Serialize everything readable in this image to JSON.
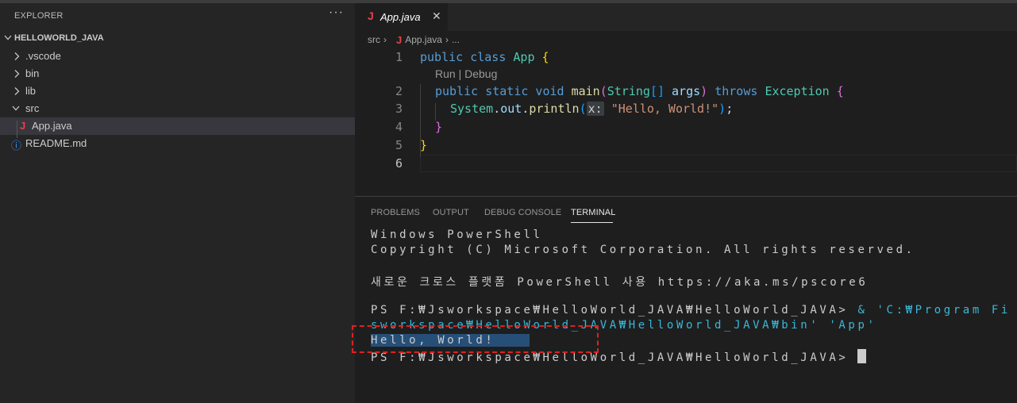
{
  "sidebar": {
    "header": "EXPLORER",
    "more": "···",
    "section_title": "HELLOWORLD_JAVA",
    "items": [
      {
        "label": ".vscode"
      },
      {
        "label": "bin"
      },
      {
        "label": "lib"
      },
      {
        "label": "src"
      },
      {
        "label": "App.java",
        "icon": "J"
      },
      {
        "label": "README.md",
        "icon": "ⓘ"
      }
    ]
  },
  "editor": {
    "tab": {
      "icon": "J",
      "label": "App.java",
      "close": "✕"
    },
    "breadcrumb": {
      "part1": "src",
      "sep": "›",
      "icon": "J",
      "part2": "App.java",
      "sep2": "›",
      "part3": "..."
    },
    "line_numbers": [
      "1",
      "2",
      "3",
      "4",
      "5",
      "6"
    ],
    "codelens": "Run | Debug",
    "code": {
      "l1_kw": "public class",
      "l1_cls": "App",
      "l1_brace": "{",
      "l2_kw": "public static void",
      "l2_fn": "main",
      "l2_paren_open": "(",
      "l2_type": "String",
      "l2_arr": "[]",
      "l2_param": "args",
      "l2_paren_close": ")",
      "l2_throws": "throws",
      "l2_exc": "Exception",
      "l2_brace": "{",
      "l3_sys": "System",
      "l3_dot1": ".",
      "l3_out": "out",
      "l3_dot2": ".",
      "l3_fn": "println",
      "l3_paren_open": "(",
      "l3_hint": "x:",
      "l3_str": "\"Hello, World!\"",
      "l3_paren_close": ")",
      "l3_semi": ";",
      "l4_brace": "}",
      "l5_brace": "}"
    }
  },
  "panel": {
    "tabs": [
      "PROBLEMS",
      "OUTPUT",
      "DEBUG CONSOLE",
      "TERMINAL"
    ],
    "active_tab": "TERMINAL",
    "terminal": {
      "line1": "Windows PowerShell",
      "line2": "Copyright (C) Microsoft Corporation. All rights reserved.",
      "line3": "새로운 크로스 플랫폼 PowerShell 사용 https://aka.ms/pscore6",
      "line4_prompt": "PS F:₩Jsworkspace₩HelloWorld_JAVA₩HelloWorld_JAVA> ",
      "line4_cmd": "& 'C:₩Program Fi",
      "line5": "sworkspace₩HelloWorld_JAVA₩HelloWorld_JAVA₩bin' 'App'",
      "line6": "Hello, World!",
      "line7_prompt": "PS F:₩Jsworkspace₩HelloWorld_JAVA₩HelloWorld_JAVA> "
    }
  },
  "colors": {
    "accent_java": "#e8404a",
    "annotation": "#e02020",
    "selection": "#264f78"
  }
}
